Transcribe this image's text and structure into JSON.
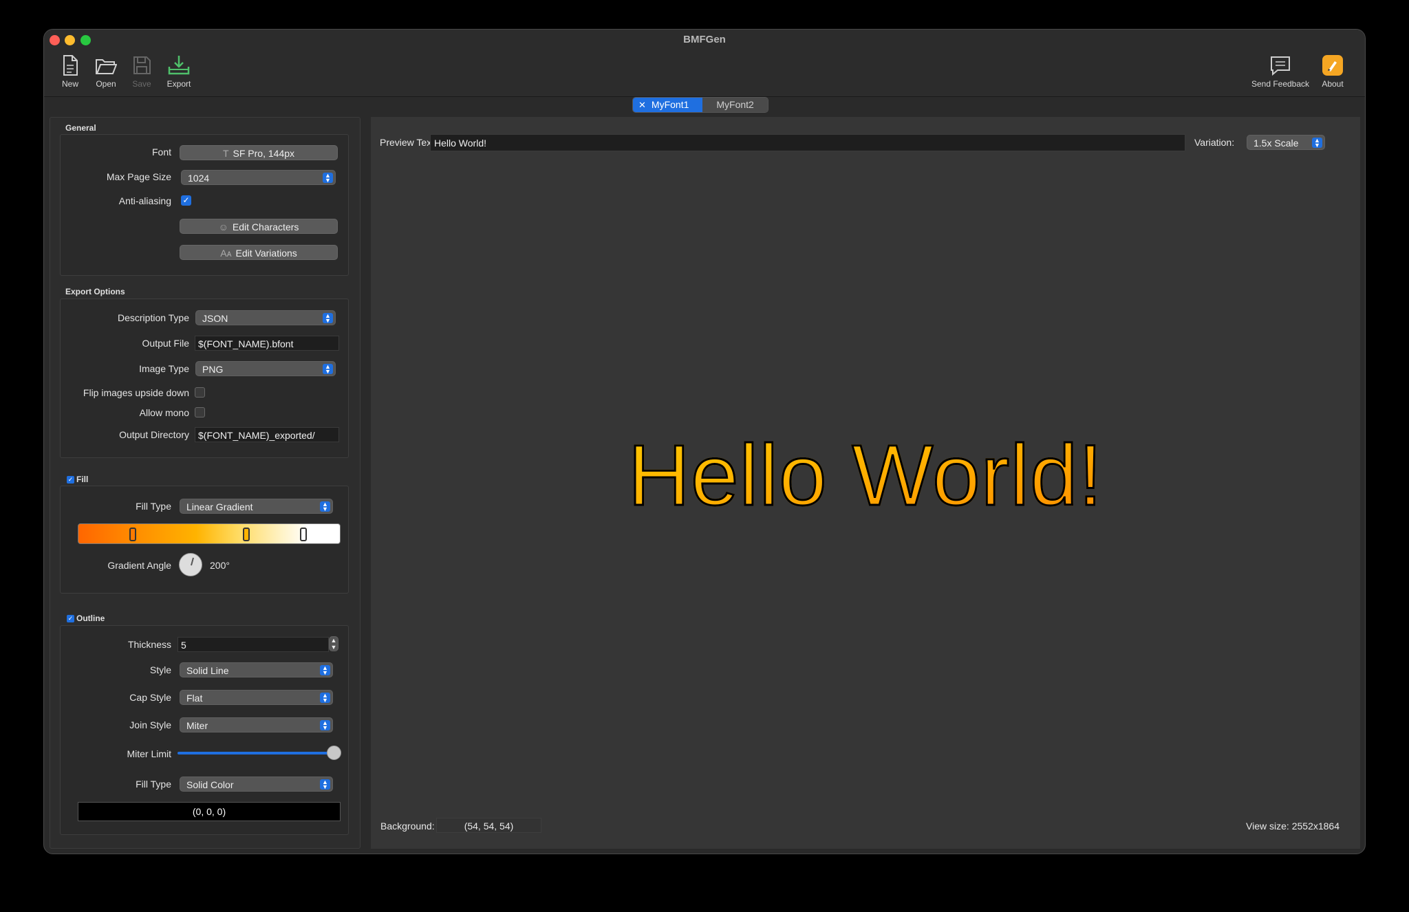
{
  "window": {
    "title": "BMFGen"
  },
  "toolbar": {
    "new_label": "New",
    "open_label": "Open",
    "save_label": "Save",
    "export_label": "Export",
    "feedback_label": "Send Feedback",
    "about_label": "About"
  },
  "tabs": [
    {
      "label": "MyFont1",
      "active": true
    },
    {
      "label": "MyFont2",
      "active": false
    }
  ],
  "general": {
    "title": "General",
    "font_label": "Font",
    "font_value": "SF Pro, 144px",
    "max_page_label": "Max Page Size",
    "max_page_value": "1024",
    "antialias_label": "Anti-aliasing",
    "antialias_checked": true,
    "edit_chars_label": "Edit Characters",
    "edit_vars_label": "Edit Variations"
  },
  "export": {
    "title": "Export Options",
    "desc_type_label": "Description Type",
    "desc_type_value": "JSON",
    "output_file_label": "Output File",
    "output_file_value": "$(FONT_NAME).bfont",
    "image_type_label": "Image Type",
    "image_type_value": "PNG",
    "flip_label": "Flip images upside down",
    "flip_checked": false,
    "mono_label": "Allow mono",
    "mono_checked": false,
    "output_dir_label": "Output Directory",
    "output_dir_value": "$(FONT_NAME)_exported/"
  },
  "fill": {
    "title": "Fill",
    "enabled": true,
    "fill_type_label": "Fill Type",
    "fill_type_value": "Linear Gradient",
    "angle_label": "Gradient Angle",
    "angle_value": "200°"
  },
  "outline": {
    "title": "Outline",
    "enabled": true,
    "thickness_label": "Thickness",
    "thickness_value": "5",
    "style_label": "Style",
    "style_value": "Solid Line",
    "cap_label": "Cap Style",
    "cap_value": "Flat",
    "join_label": "Join Style",
    "join_value": "Miter",
    "miter_label": "Miter Limit",
    "miter_level": 1.0,
    "fill_type_label": "Fill Type",
    "fill_type_value": "Solid Color",
    "color_value": "(0, 0, 0)"
  },
  "preview": {
    "text_label": "Preview Text:",
    "text_value": "Hello World!",
    "variation_label": "Variation:",
    "variation_value": "1.5x Scale",
    "sample": "Hello World!",
    "background_label": "Background:",
    "background_value": "(54, 54, 54)",
    "view_size": "View size: 2552x1864"
  },
  "colors": {
    "accent": "#1f6fe0",
    "preview_bg": "#363636"
  }
}
